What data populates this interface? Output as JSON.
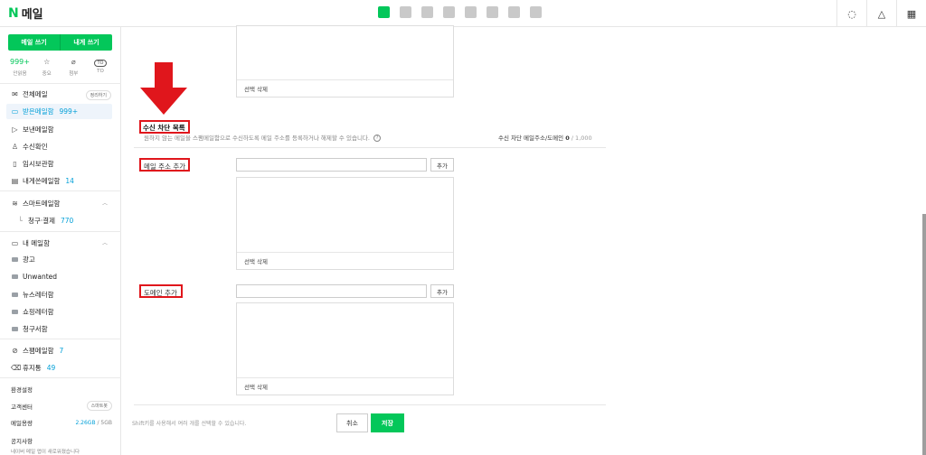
{
  "header": {
    "logo_n": "N",
    "app_name": "메일"
  },
  "sidebar": {
    "write_mail": "메일 쓰기",
    "write_self": "내게 쓰기",
    "quick": [
      {
        "top": "999+",
        "label": "안읽음"
      },
      {
        "top": "☆",
        "label": "중요"
      },
      {
        "top": "⌀",
        "label": "첨부"
      },
      {
        "top": "TO",
        "label": "TO"
      }
    ],
    "all_mail": "전체메일",
    "organize": "정리하기",
    "inbox": "받은메일함",
    "inbox_count": "999+",
    "sent": "보낸메일함",
    "read_receipt": "수신확인",
    "drafts": "임시보관함",
    "to_me": "내게쓴메일함",
    "to_me_count": "14",
    "smart": "스마트메일함",
    "billing": "청구·결제",
    "billing_count": "770",
    "my_folders": "내 메일함",
    "folders": [
      "광고",
      "Unwanted",
      "뉴스레터함",
      "쇼핑레터함",
      "청구서함"
    ],
    "spam": "스팸메일함",
    "spam_count": "7",
    "trash": "휴지통",
    "trash_count": "49",
    "settings": "환경설정",
    "support": "고객센터",
    "smartbot": "스마트봇",
    "storage": "메일용량",
    "storage_used": "2.26GB",
    "storage_total": "/ 5GB",
    "notice": "공지사항",
    "notice_text": "네이버 메일 앱이 새로워졌습니다"
  },
  "main": {
    "delete_selected": "선택 삭제",
    "block_title": "수신 차단 목록",
    "block_desc": "원하지 않는 메일을 스팸메일함으로 수신하도록 메일 주소를 등록하거나 해제할 수 있습니다.",
    "help": "?",
    "count_label": "수신 차단 메일주소/도메인",
    "count_value": "0",
    "count_total": "/ 1,000",
    "add_email_label": "메일 주소 추가",
    "add_domain_label": "도메인 추가",
    "add_button": "추가",
    "shift_hint": "Shift키를 사용해서 여러 개를 선택할 수 있습니다.",
    "cancel": "취소",
    "save": "저장"
  },
  "colors": {
    "brand": "#03c75a",
    "highlight": "#e0161c",
    "link": "#03a0d8"
  }
}
